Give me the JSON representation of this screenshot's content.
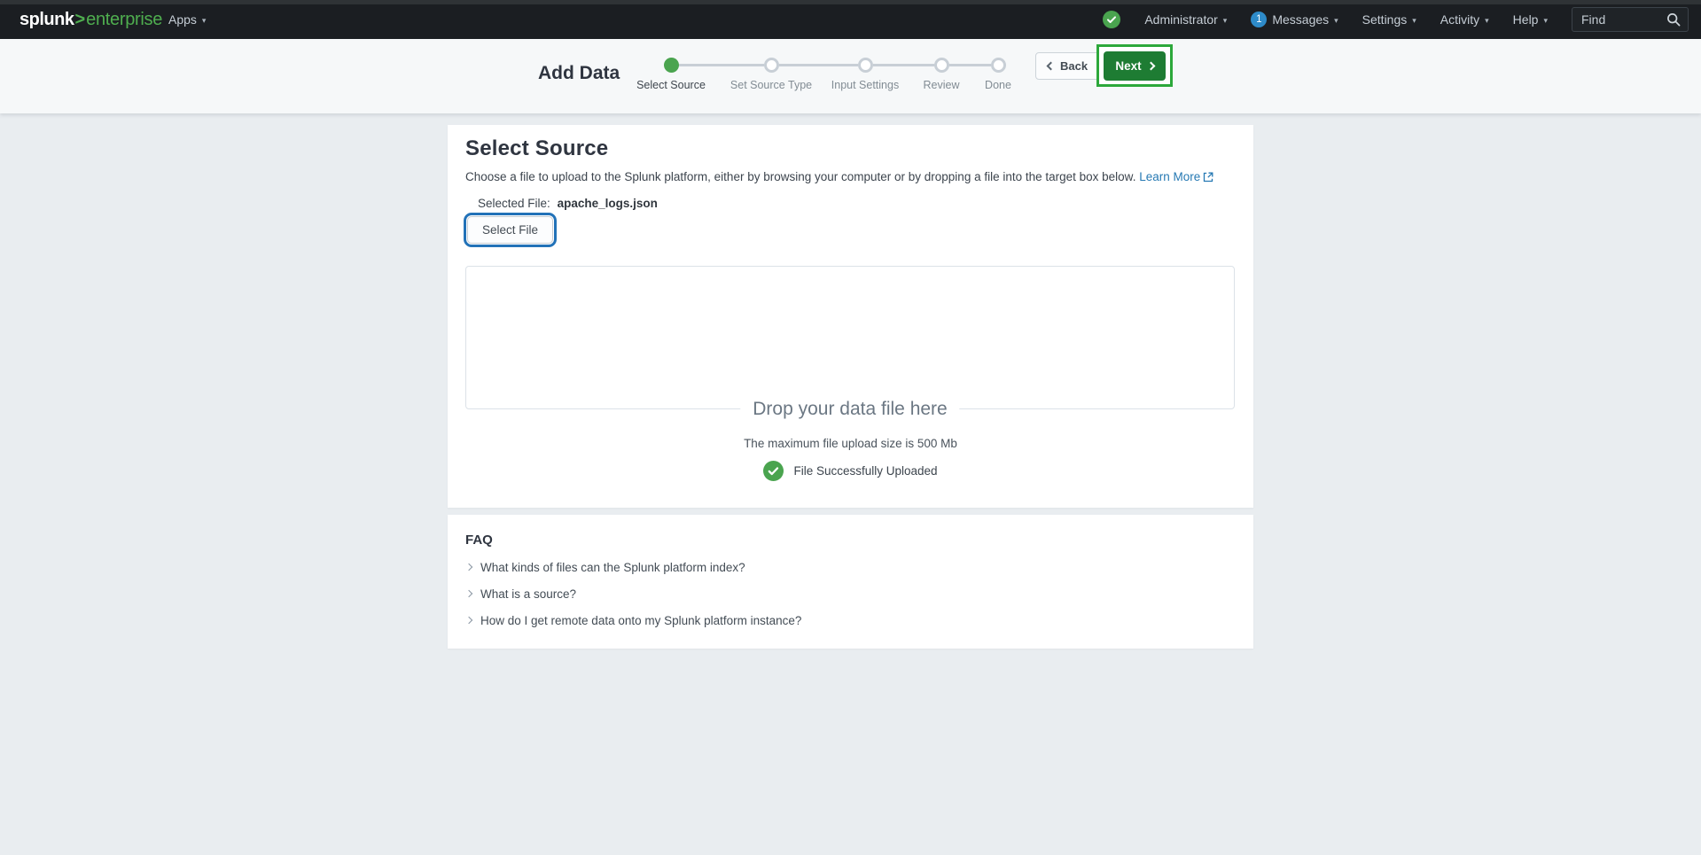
{
  "topnav": {
    "logo_brand": "splunk",
    "logo_gt": ">",
    "logo_product": "enterprise",
    "apps": "Apps",
    "administrator": "Administrator",
    "messages_count": "1",
    "messages": "Messages",
    "settings": "Settings",
    "activity": "Activity",
    "help": "Help",
    "find_placeholder": "Find"
  },
  "wizard": {
    "title": "Add Data",
    "steps": [
      {
        "label": "Select Source",
        "status": "current"
      },
      {
        "label": "Set Source Type",
        "status": "pending"
      },
      {
        "label": "Input Settings",
        "status": "pending"
      },
      {
        "label": "Review",
        "status": "pending"
      },
      {
        "label": "Done",
        "status": "pending"
      }
    ],
    "back": "Back",
    "next": "Next"
  },
  "main": {
    "heading": "Select Source",
    "description": "Choose a file to upload to the Splunk platform, either by browsing your computer or by dropping a file into the target box below.",
    "learn_more": "Learn More",
    "selected_file_label": "Selected File:",
    "selected_file_name": "apache_logs.json",
    "select_file_button": "Select File",
    "dropzone_label": "Drop your data file here",
    "max_size_text": "The maximum file upload size is 500 Mb",
    "upload_status": "File Successfully Uploaded"
  },
  "faq": {
    "heading": "FAQ",
    "items": [
      "What kinds of files can the Splunk platform index?",
      "What is a source?",
      "How do I get remote data onto my Splunk platform instance?"
    ]
  },
  "icons": {
    "dropdown_caret": "▾"
  },
  "colors": {
    "nav_bg": "#1b1e22",
    "brand_green": "#4fae4f",
    "badge_blue": "#2e8bc9",
    "step_active_green": "#4aa44f",
    "next_button_green": "#1e7c33",
    "highlight_frame_green": "#2ca83b",
    "link_blue": "#2679b3",
    "focus_ring_blue": "#2272b8",
    "success_green": "#4aa44f"
  }
}
